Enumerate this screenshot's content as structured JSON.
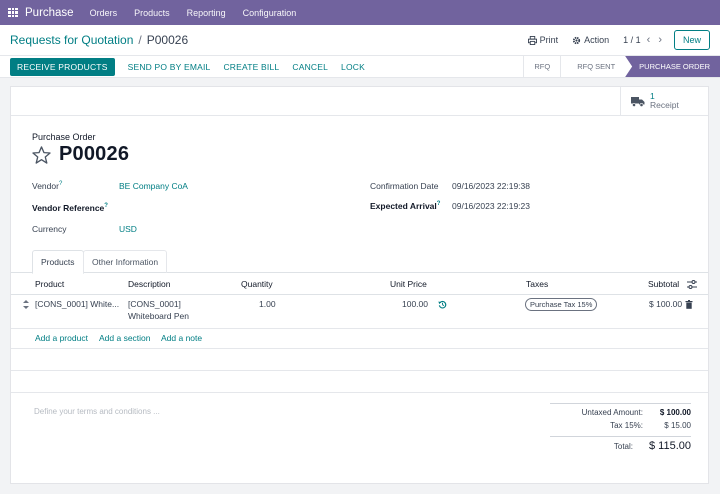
{
  "navbar": {
    "brand": "Purchase",
    "menu": [
      "Orders",
      "Products",
      "Reporting",
      "Configuration"
    ]
  },
  "breadcrumb": {
    "parent": "Requests for Quotation",
    "separator": "/",
    "current": "P00026"
  },
  "control": {
    "print_label": "Print",
    "action_label": "Action",
    "pager": "1 / 1",
    "new_label": "New"
  },
  "actions": {
    "receive": "RECEIVE PRODUCTS",
    "send_po": "SEND PO BY EMAIL",
    "create_bill": "CREATE BILL",
    "cancel": "CANCEL",
    "lock": "LOCK"
  },
  "statusbar": [
    "RFQ",
    "RFQ SENT",
    "PURCHASE ORDER"
  ],
  "smart_button": {
    "count": "1",
    "label": "Receipt"
  },
  "form": {
    "title_label": "Purchase Order",
    "number": "P00026",
    "vendor_label": "Vendor",
    "vendor_value": "BE Company CoA",
    "vendor_ref_label": "Vendor Reference",
    "currency_label": "Currency",
    "currency_value": "USD",
    "confirmation_label": "Confirmation Date",
    "confirmation_value": "09/16/2023 22:19:38",
    "expected_label": "Expected Arrival",
    "expected_value": "09/16/2023 22:19:23",
    "tooltip_mark": "?"
  },
  "tabs": [
    "Products",
    "Other Information"
  ],
  "table": {
    "headers": [
      "Product",
      "Description",
      "Quantity",
      "Unit Price",
      "Taxes",
      "Subtotal"
    ],
    "row": {
      "product": "[CONS_0001] White...",
      "description_line1": "[CONS_0001]",
      "description_line2": "Whiteboard Pen",
      "quantity": "1.00",
      "unit_price": "100.00",
      "tax": "Purchase Tax 15%",
      "subtotal": "$ 100.00"
    },
    "add_product": "Add a product",
    "add_section": "Add a section",
    "add_note": "Add a note"
  },
  "terms_placeholder": "Define your terms and conditions ...",
  "totals": {
    "untaxed_label": "Untaxed Amount:",
    "untaxed_value": "$ 100.00",
    "tax_label": "Tax 15%:",
    "tax_value": "$ 15.00",
    "total_label": "Total:",
    "total_value": "$ 115.00"
  },
  "colors": {
    "brand": "#71639e",
    "accent": "#017e84"
  }
}
